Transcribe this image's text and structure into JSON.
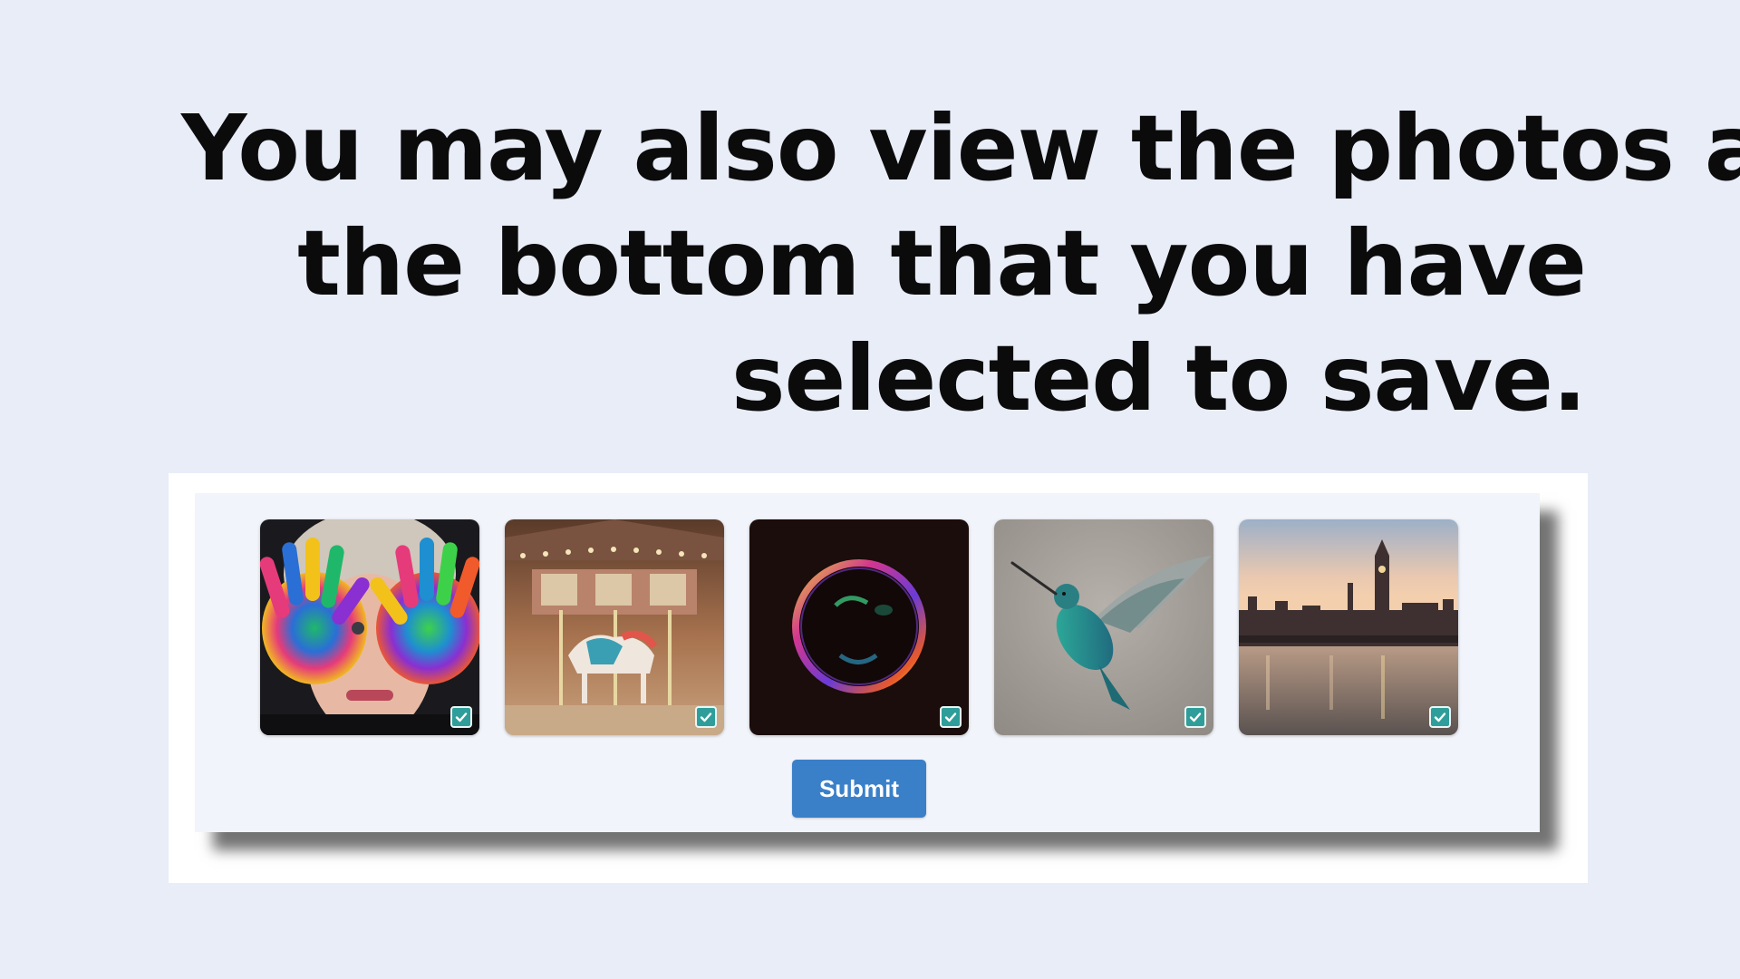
{
  "headline": {
    "line1": "You may also view the photos at",
    "line2": "the bottom that you have",
    "line3": "selected to save."
  },
  "gallery": {
    "photos": [
      {
        "subject": "painted-hands-child",
        "selected": true
      },
      {
        "subject": "carousel",
        "selected": true
      },
      {
        "subject": "soap-bubble",
        "selected": true
      },
      {
        "subject": "hummingbird",
        "selected": true
      },
      {
        "subject": "london-skyline",
        "selected": true
      }
    ],
    "check_color": "#2f9e9a",
    "check_icon": "checkmark-icon"
  },
  "submit": {
    "label": "Submit",
    "color": "#3a80c8"
  },
  "colors": {
    "page_background": "#e9edf8",
    "panel_background": "#f1f4fa"
  }
}
